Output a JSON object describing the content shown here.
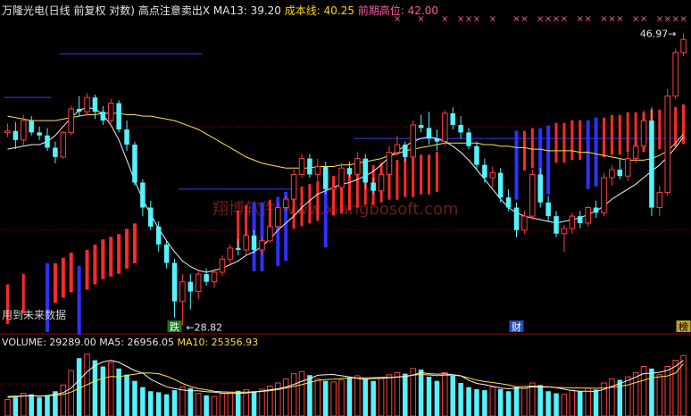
{
  "header": {
    "title": "万隆光电(日线 前复权 对数)",
    "signal_label": "高点注意卖出X",
    "ma13_label": "MA13: 39.20",
    "cost_label": "成本线: 40.25",
    "prev_high_label": "前期高位: 42.00"
  },
  "volume_header": {
    "volume_label": "VOLUME: 29289.00",
    "ma5_label": "MA5: 26956.05",
    "ma10_label": "MA10: 25356.93"
  },
  "annotations": {
    "low_price": "28.82",
    "high_price": "46.97",
    "future_note": "用到未来数据",
    "watermark": "翔博软件 www.xiangbosoft.com",
    "marker_die": "跌",
    "marker_cai": "财",
    "marker_bang": "榜"
  },
  "colors": {
    "up": "#ff3d3d",
    "down": "#54f3ff",
    "ma_white": "#f2f2f2",
    "ma_yellow": "#ffe04a",
    "hline": "#2d43ff",
    "pink": "#ff5a9c",
    "grid": "#8a0000"
  },
  "chart_data": {
    "type": "candlestick",
    "price_range": [
      28.5,
      48.5
    ],
    "candles": [
      [
        39.8,
        40.4,
        39.5,
        39.9
      ],
      [
        39.9,
        40.5,
        38.7,
        39.3
      ],
      [
        39.3,
        41.0,
        38.9,
        40.6
      ],
      [
        40.6,
        40.9,
        39.6,
        39.8
      ],
      [
        39.8,
        40.2,
        39.3,
        39.6
      ],
      [
        39.6,
        40.1,
        38.6,
        38.8
      ],
      [
        38.8,
        39.2,
        37.8,
        38.2
      ],
      [
        38.2,
        39.9,
        38.1,
        39.8
      ],
      [
        39.8,
        41.6,
        39.6,
        41.4
      ],
      [
        41.4,
        42.3,
        40.9,
        41.2
      ],
      [
        41.2,
        42.5,
        41.0,
        42.2
      ],
      [
        42.2,
        42.4,
        40.7,
        41.2
      ],
      [
        41.2,
        41.6,
        40.3,
        40.6
      ],
      [
        40.6,
        42.1,
        40.4,
        41.8
      ],
      [
        41.8,
        42.0,
        39.8,
        40.0
      ],
      [
        40.0,
        40.6,
        38.6,
        39.0
      ],
      [
        39.0,
        39.2,
        36.4,
        36.6
      ],
      [
        36.6,
        36.8,
        34.6,
        35.1
      ],
      [
        35.1,
        35.5,
        33.8,
        34.0
      ],
      [
        34.0,
        34.3,
        32.6,
        33.0
      ],
      [
        33.0,
        33.2,
        31.7,
        32.0
      ],
      [
        32.0,
        32.2,
        29.2,
        30.0
      ],
      [
        30.0,
        31.4,
        28.82,
        31.0
      ],
      [
        31.0,
        31.4,
        29.6,
        30.5
      ],
      [
        30.5,
        31.6,
        30.1,
        31.4
      ],
      [
        31.4,
        31.7,
        30.8,
        31.0
      ],
      [
        31.0,
        31.7,
        30.7,
        31.5
      ],
      [
        31.5,
        32.4,
        31.3,
        32.2
      ],
      [
        32.2,
        33.0,
        31.9,
        32.8
      ],
      [
        32.8,
        33.3,
        32.4,
        32.7
      ],
      [
        32.7,
        33.7,
        32.4,
        33.5
      ],
      [
        33.5,
        33.8,
        32.5,
        32.7
      ],
      [
        32.7,
        33.4,
        32.4,
        33.2
      ],
      [
        33.2,
        34.1,
        33.1,
        34.0
      ],
      [
        34.0,
        35.4,
        33.9,
        35.1
      ],
      [
        35.1,
        35.8,
        34.9,
        35.6
      ],
      [
        35.6,
        37.4,
        35.4,
        37.1
      ],
      [
        37.1,
        38.4,
        36.9,
        38.1
      ],
      [
        38.1,
        38.4,
        36.9,
        37.1
      ],
      [
        37.1,
        38.1,
        36.7,
        37.6
      ],
      [
        37.6,
        37.9,
        35.9,
        36.2
      ],
      [
        36.2,
        36.8,
        35.6,
        36.3
      ],
      [
        36.3,
        37.8,
        36.1,
        37.5
      ],
      [
        37.5,
        37.9,
        36.9,
        37.1
      ],
      [
        37.1,
        38.5,
        37.0,
        38.1
      ],
      [
        38.1,
        38.4,
        36.2,
        36.6
      ],
      [
        36.6,
        36.9,
        35.9,
        36.1
      ],
      [
        36.1,
        37.4,
        35.9,
        37.1
      ],
      [
        37.1,
        38.9,
        37.0,
        38.5
      ],
      [
        38.5,
        39.6,
        38.3,
        39.0
      ],
      [
        39.0,
        39.2,
        37.9,
        38.2
      ],
      [
        38.2,
        40.6,
        38.0,
        40.3
      ],
      [
        40.3,
        41.0,
        39.8,
        40.1
      ],
      [
        40.1,
        41.2,
        39.0,
        39.4
      ],
      [
        39.4,
        40.0,
        38.6,
        39.2
      ],
      [
        39.2,
        41.3,
        38.9,
        41.1
      ],
      [
        41.1,
        41.5,
        40.0,
        40.3
      ],
      [
        40.3,
        40.9,
        39.4,
        39.8
      ],
      [
        39.8,
        40.1,
        38.7,
        38.9
      ],
      [
        38.9,
        39.2,
        37.4,
        37.7
      ],
      [
        37.7,
        38.1,
        36.6,
        36.9
      ],
      [
        36.9,
        37.6,
        36.3,
        37.2
      ],
      [
        37.2,
        37.5,
        35.4,
        35.7
      ],
      [
        35.7,
        36.2,
        34.9,
        35.1
      ],
      [
        35.1,
        35.4,
        33.4,
        33.8
      ],
      [
        33.8,
        34.9,
        33.6,
        34.6
      ],
      [
        34.6,
        37.4,
        34.4,
        37.1
      ],
      [
        37.1,
        37.5,
        35.1,
        35.4
      ],
      [
        35.4,
        35.8,
        34.3,
        34.6
      ],
      [
        34.6,
        34.9,
        33.4,
        33.6
      ],
      [
        33.6,
        34.1,
        32.6,
        33.9
      ],
      [
        33.9,
        34.8,
        33.6,
        34.6
      ],
      [
        34.6,
        34.9,
        33.9,
        34.2
      ],
      [
        34.2,
        35.2,
        34.0,
        35.1
      ],
      [
        35.1,
        35.5,
        34.5,
        34.8
      ],
      [
        34.8,
        37.2,
        34.6,
        36.9
      ],
      [
        36.9,
        37.7,
        36.4,
        37.4
      ],
      [
        37.4,
        38.1,
        36.8,
        37.0
      ],
      [
        37.0,
        38.6,
        36.7,
        38.1
      ],
      [
        38.1,
        39.8,
        37.8,
        38.9
      ],
      [
        38.9,
        41.3,
        38.7,
        40.6
      ],
      [
        40.6,
        41.5,
        34.6,
        35.1
      ],
      [
        35.1,
        36.4,
        34.6,
        36.0
      ],
      [
        36.0,
        42.8,
        35.8,
        42.3
      ],
      [
        42.3,
        45.8,
        42.1,
        45.5
      ],
      [
        45.5,
        46.97,
        45.2,
        46.5
      ]
    ],
    "ma_white": [
      38.7,
      38.8,
      38.9,
      39.0,
      39.0,
      39.2,
      39.6,
      40.2,
      40.8,
      41.3,
      41.5,
      41.4,
      41.0,
      40.3,
      39.3,
      38.0,
      36.7,
      35.6,
      34.7,
      33.9,
      33.2,
      32.6,
      32.1,
      31.8,
      31.6,
      31.5,
      31.6,
      31.7,
      31.9,
      32.1,
      32.4,
      32.6,
      32.9,
      33.3,
      33.8,
      34.2,
      34.6,
      35.1,
      35.5,
      35.9,
      36.1,
      36.3,
      36.5,
      36.6,
      36.8,
      37.0,
      37.3,
      37.7,
      38.2,
      38.6,
      38.9,
      39.2,
      39.4,
      39.5,
      39.4,
      39.2,
      38.9,
      38.5,
      38.0,
      37.4,
      36.8,
      36.2,
      35.6,
      35.1,
      34.8,
      34.6,
      34.5,
      34.4,
      34.3,
      34.2,
      34.3,
      34.4,
      34.5,
      34.7,
      34.9,
      35.2,
      35.6,
      35.9,
      36.2,
      36.5,
      36.9,
      37.3,
      37.7,
      38.2,
      38.8,
      39.5
    ],
    "ma_yellow": [
      40.9,
      40.8,
      40.7,
      40.6,
      40.6,
      40.6,
      40.6,
      40.7,
      40.8,
      40.9,
      41.0,
      41.0,
      41.1,
      41.1,
      41.1,
      41.0,
      41.0,
      40.9,
      40.9,
      40.8,
      40.7,
      40.6,
      40.4,
      40.2,
      40.0,
      39.7,
      39.4,
      39.1,
      38.8,
      38.5,
      38.2,
      38.0,
      37.8,
      37.7,
      37.6,
      37.5,
      37.5,
      37.5,
      37.5,
      37.6,
      37.6,
      37.6,
      37.7,
      37.7,
      37.8,
      37.9,
      38.0,
      38.1,
      38.3,
      38.4,
      38.6,
      38.7,
      38.8,
      38.9,
      39.0,
      39.1,
      39.1,
      39.1,
      39.1,
      39.1,
      39.0,
      39.0,
      38.9,
      38.9,
      38.8,
      38.8,
      38.7,
      38.7,
      38.6,
      38.6,
      38.6,
      38.6,
      38.5,
      38.5,
      38.4,
      38.3,
      38.2,
      38.1,
      38.0,
      38.0,
      38.0,
      38.1,
      38.3,
      38.6,
      39.1,
      39.7
    ],
    "volume_range": [
      0,
      32000
    ],
    "volume": [
      8000,
      9000,
      11000,
      10500,
      9000,
      10000,
      12000,
      15000,
      22000,
      28000,
      30000,
      27000,
      24000,
      26000,
      23000,
      20000,
      17000,
      14000,
      12000,
      11500,
      10500,
      12500,
      14000,
      13500,
      11000,
      10000,
      9500,
      10800,
      11500,
      12200,
      12800,
      12000,
      13000,
      14500,
      16000,
      18000,
      20500,
      21500,
      19800,
      18000,
      17000,
      16500,
      17500,
      18500,
      19500,
      18000,
      17000,
      18200,
      20000,
      21000,
      20500,
      23000,
      22500,
      19000,
      17000,
      21000,
      19500,
      16000,
      14000,
      13000,
      12500,
      14000,
      13000,
      12000,
      14000,
      13500,
      16000,
      15000,
      12000,
      11000,
      10500,
      12500,
      12000,
      13500,
      12800,
      16000,
      18000,
      17500,
      19000,
      21000,
      24000,
      23000,
      20000,
      24000,
      27000,
      29289
    ],
    "volume_ma5": [
      9000,
      9300,
      9700,
      9900,
      9500,
      9900,
      10500,
      11300,
      13600,
      17400,
      21400,
      24400,
      26200,
      27000,
      26000,
      24000,
      22000,
      20800,
      17800,
      15900,
      14200,
      13300,
      12600,
      12200,
      12200,
      11800,
      11600,
      11100,
      10900,
      11000,
      11100,
      11600,
      12100,
      12700,
      13200,
      14000,
      15300,
      16800,
      18100,
      19700,
      20000,
      20100,
      19500,
      19000,
      18200,
      17900,
      18100,
      18300,
      18500,
      19000,
      19000,
      19900,
      21000,
      20500,
      20300,
      20400,
      20000,
      19500,
      17300,
      15800,
      15200,
      14400,
      13600,
      13200,
      13600,
      13400,
      14100,
      14000,
      14100,
      13700,
      13000,
      12300,
      12000,
      12000,
      11900,
      12900,
      14400,
      15700,
      17200,
      18800,
      20600,
      20700,
      21200,
      22100,
      24100,
      26956
    ],
    "volume_ma10": [
      9500,
      9600,
      9700,
      9800,
      9700,
      9800,
      10000,
      10400,
      11600,
      13400,
      15200,
      16900,
      18300,
      19100,
      19000,
      19700,
      20200,
      20900,
      20800,
      20500,
      19300,
      17700,
      15800,
      14300,
      13300,
      12700,
      12000,
      11700,
      11600,
      11500,
      11600,
      11700,
      11900,
      12300,
      12800,
      13600,
      14400,
      15200,
      16200,
      17200,
      17700,
      17800,
      18200,
      18500,
      18400,
      18500,
      18600,
      18700,
      18700,
      18800,
      19300,
      19800,
      20100,
      19900,
      19600,
      19800,
      19800,
      19400,
      18400,
      17400,
      16700,
      16200,
      15700,
      15000,
      14200,
      14300,
      14500,
      14300,
      14100,
      13800,
      13800,
      13600,
      13600,
      13500,
      13400,
      13600,
      13900,
      14300,
      15000,
      16200,
      17300,
      18500,
      19000,
      19400,
      20800,
      25357
    ],
    "signal_bars": [
      [
        0,
        "red",
        1.8,
        3
      ],
      [
        2,
        "red",
        2.2,
        3
      ],
      [
        5,
        "blue",
        2.6,
        4
      ],
      [
        6,
        "red",
        2.6,
        4
      ],
      [
        7,
        "red",
        2.8,
        4
      ],
      [
        8,
        "red",
        3.0,
        4
      ],
      [
        9,
        "blue",
        2.5,
        4
      ],
      [
        10,
        "red",
        3.1,
        4
      ],
      [
        11,
        "red",
        3.3,
        4
      ],
      [
        12,
        "red",
        3.5,
        4
      ],
      [
        13,
        "red",
        3.6,
        4
      ],
      [
        14,
        "red",
        3.7,
        4
      ],
      [
        15,
        "red",
        3.9,
        4
      ],
      [
        16,
        "red",
        4.1,
        4
      ],
      [
        29,
        "red",
        4.6,
        3
      ],
      [
        30,
        "red",
        4.8,
        3
      ],
      [
        31,
        "blue",
        4.9,
        4
      ],
      [
        32,
        "blue",
        4.9,
        4
      ],
      [
        33,
        "red",
        5.0,
        3
      ],
      [
        34,
        "blue",
        5.1,
        4
      ],
      [
        35,
        "blue",
        5.3,
        4
      ],
      [
        36,
        "red",
        5.4,
        3
      ],
      [
        37,
        "red",
        5.5,
        3
      ],
      [
        38,
        "red",
        5.6,
        3
      ],
      [
        39,
        "red",
        5.7,
        3
      ],
      [
        40,
        "blue",
        5.8,
        4
      ],
      [
        41,
        "red",
        5.9,
        3
      ],
      [
        42,
        "red",
        6.0,
        3
      ],
      [
        43,
        "red",
        6.1,
        3
      ],
      [
        44,
        "red",
        6.2,
        3
      ],
      [
        45,
        "red",
        6.3,
        3
      ],
      [
        46,
        "red",
        6.3,
        3
      ],
      [
        47,
        "red",
        6.4,
        3
      ],
      [
        48,
        "red",
        6.5,
        3
      ],
      [
        49,
        "red",
        6.5,
        3
      ],
      [
        50,
        "red",
        6.6,
        3
      ],
      [
        51,
        "red",
        6.6,
        3
      ],
      [
        52,
        "red",
        6.7,
        3
      ],
      [
        53,
        "red",
        6.7,
        3
      ],
      [
        54,
        "red",
        6.8,
        3
      ],
      [
        64,
        "blue",
        7.6,
        4
      ],
      [
        65,
        "red",
        7.6,
        3
      ],
      [
        66,
        "red",
        7.7,
        3
      ],
      [
        67,
        "blue",
        7.7,
        4
      ],
      [
        68,
        "blue",
        7.8,
        4
      ],
      [
        69,
        "red",
        7.9,
        3
      ],
      [
        70,
        "red",
        7.9,
        3
      ],
      [
        71,
        "red",
        8.0,
        3
      ],
      [
        72,
        "red",
        8.0,
        3
      ],
      [
        73,
        "blue",
        8.0,
        4
      ],
      [
        74,
        "blue",
        8.1,
        4
      ],
      [
        75,
        "red",
        8.1,
        3
      ],
      [
        76,
        "red",
        8.2,
        3
      ],
      [
        77,
        "red",
        8.2,
        3
      ],
      [
        78,
        "red",
        8.3,
        3
      ],
      [
        79,
        "red",
        8.3,
        3
      ],
      [
        80,
        "red",
        8.3,
        3
      ],
      [
        81,
        "red",
        8.4,
        3
      ],
      [
        82,
        "red",
        8.4,
        3
      ],
      [
        83,
        "red",
        8.5,
        3
      ],
      [
        84,
        "red",
        8.5,
        3
      ],
      [
        85,
        "red",
        8.6,
        3
      ]
    ],
    "signal_range": [
      0,
      12
    ],
    "x_marks": [
      49,
      52,
      55,
      57,
      58,
      59,
      61,
      64,
      65,
      67,
      68,
      69,
      70,
      72,
      73,
      75,
      76,
      77,
      79,
      80,
      82,
      83,
      84,
      85
    ],
    "hlines": [
      {
        "from": 7,
        "to": 24,
        "price": 45.4
      },
      {
        "from": 0,
        "to": 5,
        "price": 42.2
      },
      {
        "from": 44,
        "to": 85,
        "price": 39.4
      },
      {
        "from": 22,
        "to": 36,
        "price": 36.2
      }
    ]
  }
}
